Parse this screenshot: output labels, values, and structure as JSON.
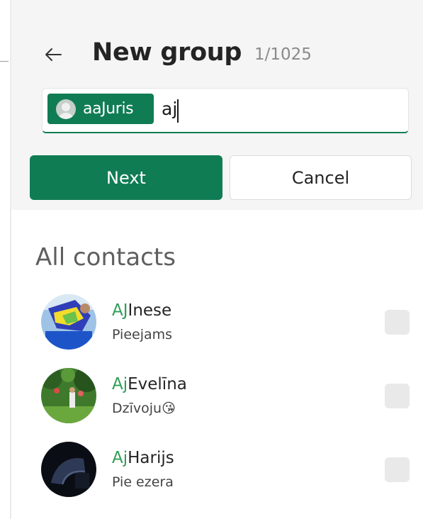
{
  "header": {
    "title": "New group",
    "count": "1/1025"
  },
  "search": {
    "chip_label": "aaJuris",
    "value": "aj"
  },
  "buttons": {
    "next": "Next",
    "cancel": "Cancel"
  },
  "contacts_section": {
    "title": "All contacts",
    "items": [
      {
        "highlight": "AJ",
        "name_rest": "Inese",
        "status": "Pieejams",
        "status_emoji": ""
      },
      {
        "highlight": "Aj",
        "name_rest": "Evelīna",
        "status": "Dzīvoju",
        "status_emoji": "😘"
      },
      {
        "highlight": "Aj",
        "name_rest": "Harijs",
        "status": "Pie ezera",
        "status_emoji": ""
      }
    ]
  },
  "colors": {
    "accent": "#107c53",
    "highlight": "#2f9e55"
  },
  "icons": {
    "back": "arrow-left-icon",
    "chip_avatar": "person-avatar-icon"
  }
}
